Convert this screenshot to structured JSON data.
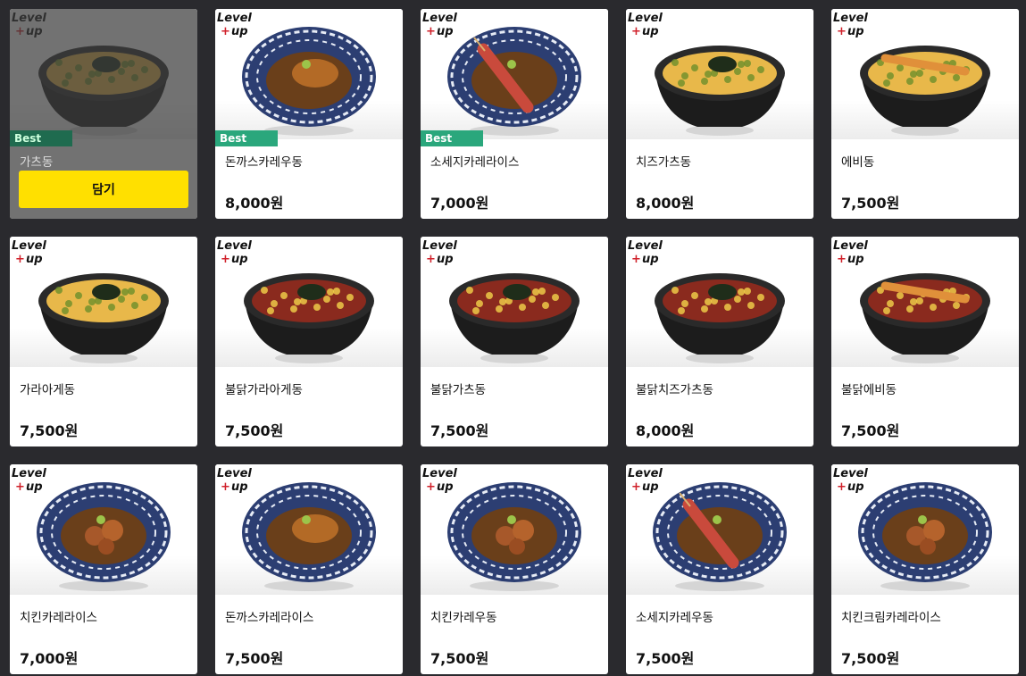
{
  "cart_button_label": "담기",
  "badge_label": "Best",
  "logo_text": "Level up",
  "colors": {
    "background": "#2a2a2e",
    "badge": "#2aa77c",
    "cart_button": "#ffe000"
  },
  "items": [
    {
      "name": "가츠동",
      "price": "",
      "best": true,
      "hovered": true,
      "bowl": "black",
      "topping": "egg"
    },
    {
      "name": "돈까스카레우동",
      "price": "8,000원",
      "best": true,
      "hovered": false,
      "bowl": "wave",
      "topping": "cutlet"
    },
    {
      "name": "소세지카레라이스",
      "price": "7,000원",
      "best": true,
      "hovered": false,
      "bowl": "wave",
      "topping": "sausage"
    },
    {
      "name": "치즈가츠동",
      "price": "8,000원",
      "best": false,
      "hovered": false,
      "bowl": "black",
      "topping": "egg"
    },
    {
      "name": "에비동",
      "price": "7,500원",
      "best": false,
      "hovered": false,
      "bowl": "black",
      "topping": "shrimp"
    },
    {
      "name": "가라아게동",
      "price": "7,500원",
      "best": false,
      "hovered": false,
      "bowl": "black",
      "topping": "karaage"
    },
    {
      "name": "불닭가라아게동",
      "price": "7,500원",
      "best": false,
      "hovered": false,
      "bowl": "black",
      "topping": "spicy"
    },
    {
      "name": "불닭가츠동",
      "price": "7,500원",
      "best": false,
      "hovered": false,
      "bowl": "black",
      "topping": "spicy"
    },
    {
      "name": "불닭치즈가츠동",
      "price": "8,000원",
      "best": false,
      "hovered": false,
      "bowl": "black",
      "topping": "spicy"
    },
    {
      "name": "불닭에비동",
      "price": "7,500원",
      "best": false,
      "hovered": false,
      "bowl": "black",
      "topping": "spicy-shrimp"
    },
    {
      "name": "치킨카레라이스",
      "price": "7,000원",
      "best": false,
      "hovered": false,
      "bowl": "wave",
      "topping": "chicken"
    },
    {
      "name": "돈까스카레라이스",
      "price": "7,500원",
      "best": false,
      "hovered": false,
      "bowl": "wave",
      "topping": "cutlet"
    },
    {
      "name": "치킨카레우동",
      "price": "7,500원",
      "best": false,
      "hovered": false,
      "bowl": "wave",
      "topping": "chicken"
    },
    {
      "name": "소세지카레우동",
      "price": "7,500원",
      "best": false,
      "hovered": false,
      "bowl": "wave",
      "topping": "sausage"
    },
    {
      "name": "치킨크림카레라이스",
      "price": "7,500원",
      "best": false,
      "hovered": false,
      "bowl": "wave",
      "topping": "chicken"
    }
  ]
}
